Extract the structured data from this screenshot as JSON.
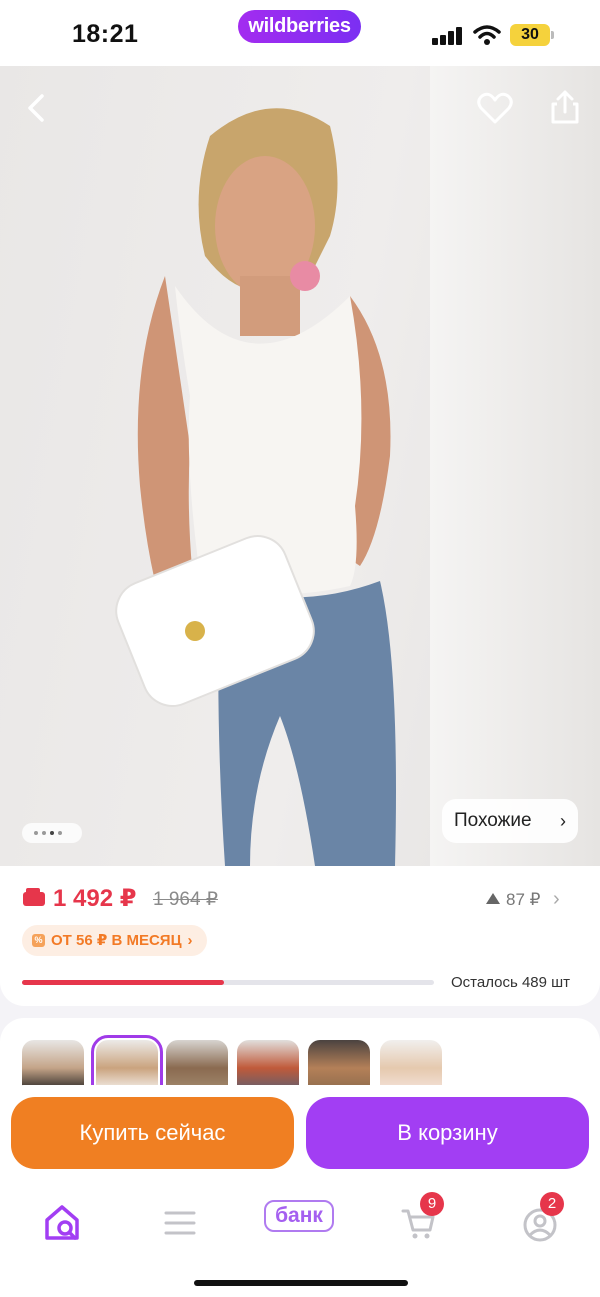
{
  "status_bar": {
    "time": "18:21",
    "battery": "30"
  },
  "brand": {
    "name": "wildberries"
  },
  "hero": {
    "images_total": 4,
    "images_current": 2,
    "similar_label": "Похожие"
  },
  "price": {
    "current": "1 492 ₽",
    "old": "1 964 ₽",
    "bonus": "87 ₽",
    "installment": "ОТ 56 ₽ В МЕСЯЦ",
    "stock_label": "Осталось 489 шт",
    "stock_fraction": 0.49
  },
  "thumbnails": {
    "count": 6,
    "active_index": 1
  },
  "actions": {
    "buy_now": "Купить сейчас",
    "to_cart": "В корзину"
  },
  "tabbar": {
    "bank_label": "банк",
    "cart_badge": "9",
    "profile_badge": "2"
  },
  "colors": {
    "brand_purple": "#a23ef3",
    "buy_orange": "#f07f22",
    "price_red": "#e6364b"
  }
}
